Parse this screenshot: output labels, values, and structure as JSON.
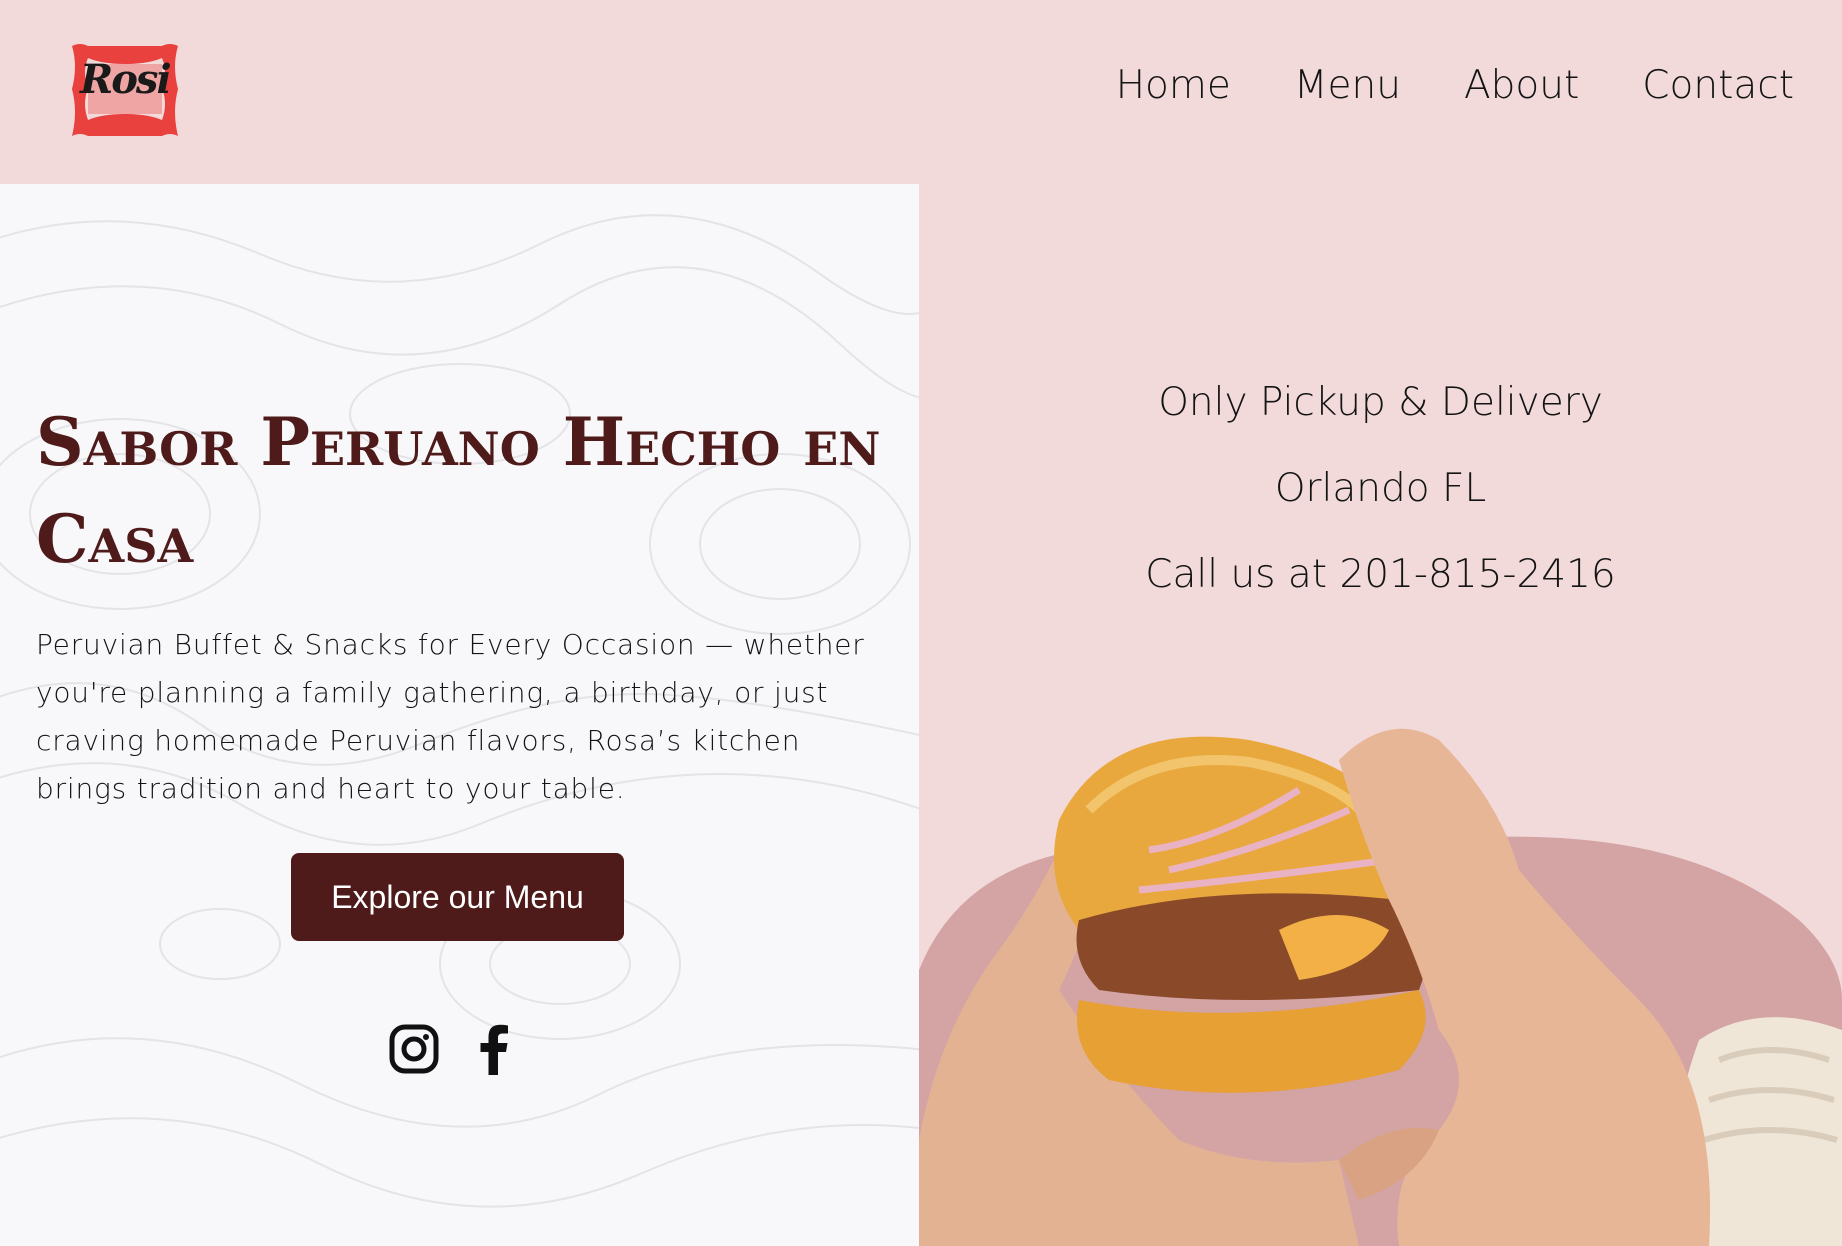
{
  "colors": {
    "page_bg": "#f2dada",
    "panel_bg": "#f8f8fa",
    "accent_dark": "#4e1a1a",
    "blob": "#d4a3a4",
    "logo_red": "#e8413e"
  },
  "header": {
    "logo": {
      "text": "Rosi",
      "icon": "rosi-logo"
    },
    "nav": [
      {
        "label": "Home"
      },
      {
        "label": "Menu"
      },
      {
        "label": "About"
      },
      {
        "label": "Contact"
      }
    ]
  },
  "hero": {
    "headline": "Sabor Peruano Hecho en Casa",
    "description": "Peruvian Buffet & Snacks for Every Occasion — whether you're planning a family gathering, a birthday, or just craving homemade Peruvian flavors, Rosa’s kitchen brings tradition and heart to your table.",
    "cta_label": "Explore our Menu",
    "socials": [
      {
        "icon": "instagram-icon"
      },
      {
        "icon": "facebook-icon"
      }
    ]
  },
  "info": {
    "lines": [
      "Only Pickup & Delivery",
      "Orlando FL",
      "Call us at 201-815-2416"
    ]
  }
}
